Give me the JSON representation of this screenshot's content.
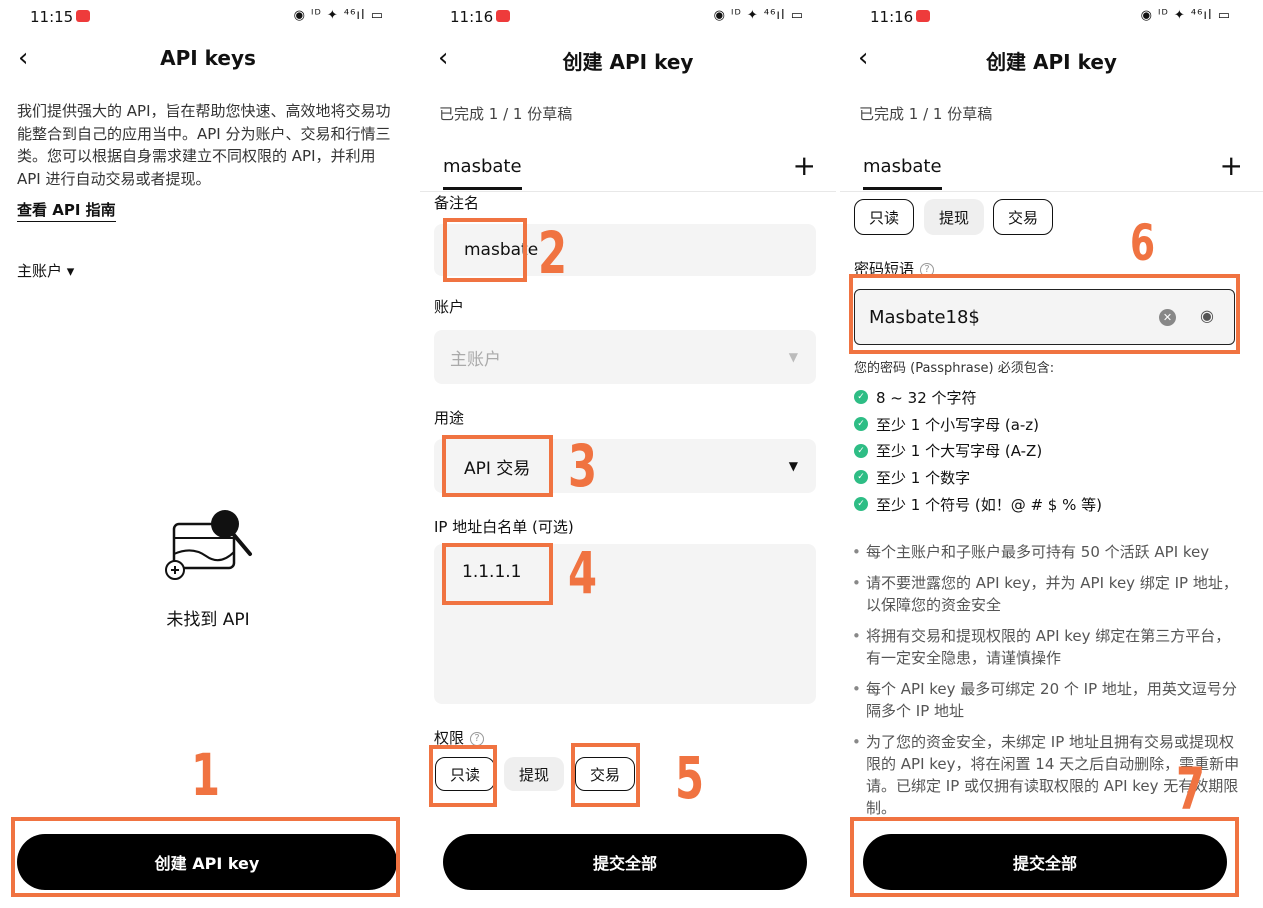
{
  "status": {
    "time1": "11:15",
    "time2": "11:16",
    "time3": "11:16",
    "icons": "◉ ᴵᴰ ✦ ⁴⁶ıl ▭"
  },
  "screen1": {
    "title": "API keys",
    "intro": "我们提供强大的 API，旨在帮助您快速、高效地将交易功能整合到自己的应用当中。API 分为账户、交易和行情三类。您可以根据自身需求建立不同权限的 API，并利用 API 进行自动交易或者提现。",
    "guide_link": "查看 API 指南",
    "account_selector": "主账户 ▾",
    "empty_text": "未找到 API",
    "create_button": "创建 API key",
    "step": "1"
  },
  "screen2": {
    "title": "创建 API key",
    "draft": "已完成 1 / 1 份草稿",
    "tab": "masbate",
    "remark_label": "备注名",
    "remark_value": "masbate",
    "account_label": "账户",
    "account_value": "主账户",
    "purpose_label": "用途",
    "purpose_value": "API 交易",
    "ip_label": "IP 地址白名单 (可选)",
    "ip_value": "1.1.1.1",
    "perm_label": "权限",
    "perm_readonly": "只读",
    "perm_withdraw": "提现",
    "perm_trade": "交易",
    "submit": "提交全部",
    "steps": [
      "2",
      "3",
      "4",
      "5"
    ]
  },
  "screen3": {
    "title": "创建 API key",
    "draft": "已完成 1 / 1 份草稿",
    "tab": "masbate",
    "perm_readonly": "只读",
    "perm_withdraw": "提现",
    "perm_trade": "交易",
    "passphrase_label": "密码短语",
    "passphrase_value": "Masbate18$",
    "req_title": "您的密码 (Passphrase) 必须包含:",
    "requirements": [
      "8 ~ 32 个字符",
      "至少 1 个小写字母 (a-z)",
      "至少 1 个大写字母 (A-Z)",
      "至少 1 个数字",
      "至少 1 个符号 (如！@ # $ % 等)"
    ],
    "notes": [
      "每个主账户和子账户最多可持有 50 个活跃 API key",
      "请不要泄露您的 API key，并为 API key 绑定 IP 地址，以保障您的资金安全",
      "将拥有交易和提现权限的 API key 绑定在第三方平台，有一定安全隐患，请谨慎操作",
      "每个 API key 最多可绑定 20 个 IP 地址，用英文逗号分隔多个 IP 地址",
      "为了您的资金安全，未绑定 IP 地址且拥有交易或提现权限的 API key，将在闲置 14 天之后自动删除，需重新申请。已绑定 IP 或仅拥有读取权限的 API key 无有效期限制。"
    ],
    "submit": "提交全部",
    "steps": [
      "6",
      "7"
    ]
  }
}
